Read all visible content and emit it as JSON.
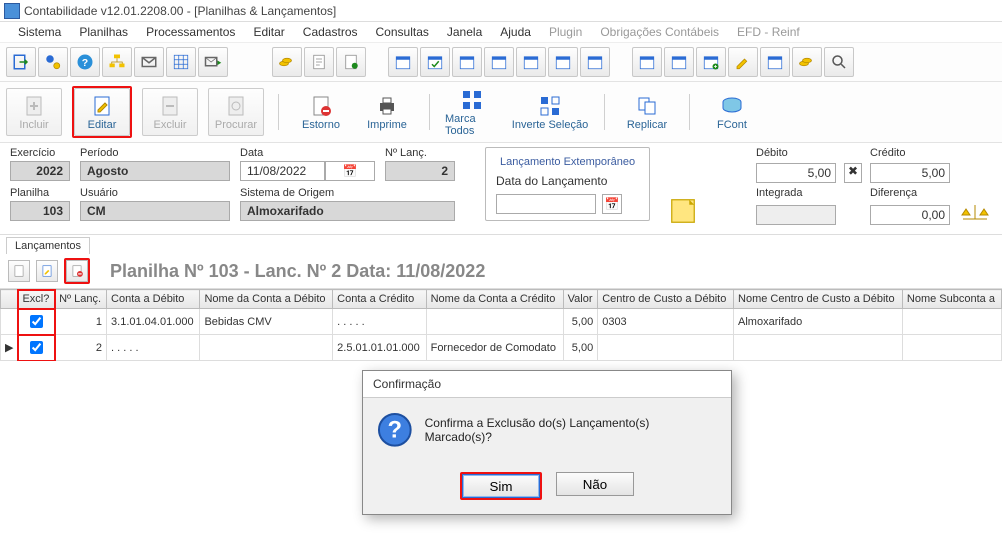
{
  "window": {
    "title": "Contabilidade v12.01.2208.00 - [Planilhas & Lançamentos]"
  },
  "menu": {
    "sistema": "Sistema",
    "planilhas": "Planilhas",
    "processamentos": "Processamentos",
    "editar": "Editar",
    "cadastros": "Cadastros",
    "consultas": "Consultas",
    "janela": "Janela",
    "ajuda": "Ajuda",
    "plugin": "Plugin",
    "obrigacoes": "Obrigações Contábeis",
    "efd": "EFD - Reinf"
  },
  "actions": {
    "incluir": "Incluir",
    "editar": "Editar",
    "excluir": "Excluir",
    "procurar": "Procurar",
    "estorno": "Estorno",
    "imprime": "Imprime",
    "marca_todos": "Marca Todos",
    "inverte_selecao": "Inverte Seleção",
    "replicar": "Replicar",
    "fcont": "FCont"
  },
  "filters": {
    "exercicio_label": "Exercício",
    "exercicio": "2022",
    "periodo_label": "Período",
    "periodo": "Agosto",
    "data_label": "Data",
    "data": "11/08/2022",
    "nlanc_label": "Nº Lanç.",
    "nlanc": "2",
    "planilha_label": "Planilha",
    "planilha": "103",
    "usuario_label": "Usuário",
    "usuario": "CM",
    "origem_label": "Sistema de Origem",
    "origem": "Almoxarifado",
    "ext_legend": "Lançamento Extemporâneo",
    "ext_data_label": "Data do Lançamento",
    "debito_label": "Débito",
    "debito": "5,00",
    "credito_label": "Crédito",
    "credito": "5,00",
    "integrada_label": "Integrada",
    "diferenca_label": "Diferença",
    "diferenca": "0,00"
  },
  "tab": {
    "lancamentos": "Lançamentos"
  },
  "sheet_title": "Planilha Nº 103 - Lanc. Nº 2 Data: 11/08/2022",
  "columns": {
    "excl": "Excl?",
    "nlanc": "Nº Lanç.",
    "conta_debito": "Conta a Débito",
    "nome_conta_debito": "Nome da Conta a Débito",
    "conta_credito": "Conta a Crédito",
    "nome_conta_credito": "Nome da Conta a Crédito",
    "valor": "Valor",
    "ccusto_debito": "Centro de Custo a Débito",
    "nome_ccusto_debito": "Nome Centro de Custo a Débito",
    "nome_subconta": "Nome Subconta a"
  },
  "rows": [
    {
      "excl": true,
      "nlanc": "1",
      "conta_debito": "3.1.01.04.01.000",
      "nome_conta_debito": "Bebidas CMV",
      "conta_credito": ". . . . .",
      "nome_conta_credito": "",
      "valor": "5,00",
      "ccusto_debito": "0303",
      "nome_ccusto_debito": "Almoxarifado"
    },
    {
      "excl": true,
      "nlanc": "2",
      "conta_debito": ". . . . .",
      "nome_conta_debito": "",
      "conta_credito": "2.5.01.01.01.000",
      "nome_conta_credito": "Fornecedor de Comodato",
      "valor": "5,00",
      "ccusto_debito": "",
      "nome_ccusto_debito": ""
    }
  ],
  "dialog": {
    "title": "Confirmação",
    "message": "Confirma a Exclusão do(s) Lançamento(s) Marcado(s)?",
    "sim": "Sim",
    "nao": "Não"
  }
}
